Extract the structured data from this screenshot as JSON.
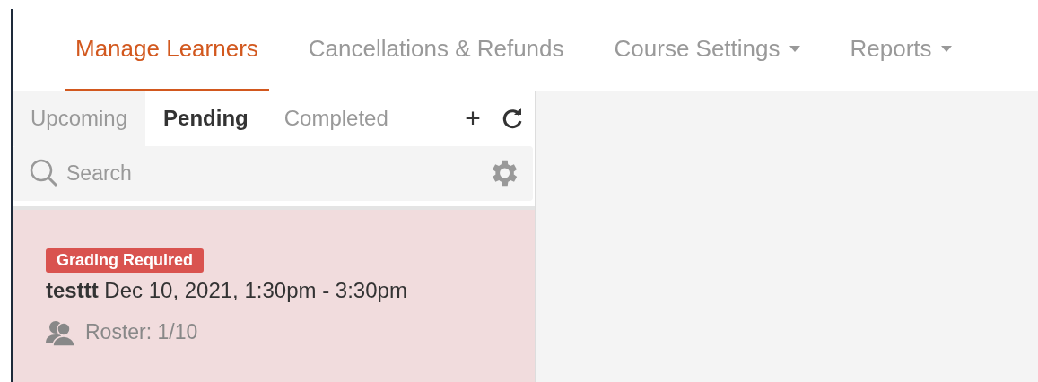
{
  "nav_tabs": [
    {
      "label": "Manage Learners",
      "selected": true,
      "dropdown": false
    },
    {
      "label": "Cancellations & Refunds",
      "selected": false,
      "dropdown": false
    },
    {
      "label": "Course Settings",
      "selected": false,
      "dropdown": true
    },
    {
      "label": "Reports",
      "selected": false,
      "dropdown": true
    }
  ],
  "sub_tabs": [
    {
      "label": "Upcoming",
      "selected": false
    },
    {
      "label": "Pending",
      "selected": true
    },
    {
      "label": "Completed",
      "selected": false
    }
  ],
  "tab_actions": [
    "+"
  ],
  "search": {
    "placeholder": "Search"
  },
  "sessions": [
    {
      "badge": "Grading Required",
      "name": "testtt",
      "time": "Dec 10, 2021, 1:30pm - 3:30pm",
      "roster": "Roster: 1/10"
    }
  ]
}
